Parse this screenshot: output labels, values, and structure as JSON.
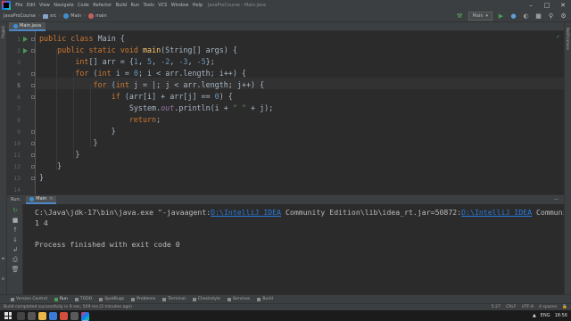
{
  "menubar": {
    "items": [
      "File",
      "Edit",
      "View",
      "Navigate",
      "Code",
      "Refactor",
      "Build",
      "Run",
      "Tools",
      "VCS",
      "Window",
      "Help"
    ],
    "window_title": "JavaProCourse - Main.java",
    "min_icon": "minimize-icon",
    "max_icon": "maximize-icon",
    "close_icon": "close-icon"
  },
  "navbar": {
    "breadcrumbs": [
      "JavaProCourse",
      "src",
      "Main",
      "main"
    ],
    "run_config": "Main"
  },
  "left_strip": {
    "labels": [
      "Project"
    ]
  },
  "right_strip": {
    "labels": [
      "Notifications"
    ]
  },
  "tabs": [
    {
      "label": "Main.java",
      "active": true
    }
  ],
  "editor": {
    "line_numbers": [
      "1",
      "2",
      "3",
      "4",
      "5",
      "6",
      "7",
      "8",
      "9",
      "10",
      "11",
      "12",
      "13",
      "14"
    ],
    "current_line": 5,
    "code": [
      [
        [
          "kw",
          "public "
        ],
        [
          "kw",
          "class "
        ],
        [
          "",
          "Main {"
        ]
      ],
      [
        [
          "",
          "    "
        ],
        [
          "kw",
          "public "
        ],
        [
          "kw",
          "static "
        ],
        [
          "kw",
          "void "
        ],
        [
          "fn",
          "main"
        ],
        [
          "",
          "(String[] args) {"
        ]
      ],
      [
        [
          "",
          "        "
        ],
        [
          "kw",
          "int"
        ],
        [
          "",
          "[] arr = {"
        ],
        [
          "num",
          "1"
        ],
        [
          "",
          ", "
        ],
        [
          "num",
          "5"
        ],
        [
          "",
          ", "
        ],
        [
          "num",
          "-2"
        ],
        [
          "",
          ", "
        ],
        [
          "num",
          "-3"
        ],
        [
          "",
          ", "
        ],
        [
          "num",
          "-5"
        ],
        [
          "",
          "};"
        ]
      ],
      [
        [
          "",
          "        "
        ],
        [
          "kw",
          "for "
        ],
        [
          "",
          "("
        ],
        [
          "kw",
          "int "
        ],
        [
          "",
          "i = "
        ],
        [
          "num",
          "0"
        ],
        [
          "",
          "; i < arr.length; i++) {"
        ]
      ],
      [
        [
          "",
          "            "
        ],
        [
          "kw",
          "for "
        ],
        [
          "",
          "("
        ],
        [
          "kw",
          "int "
        ],
        [
          "",
          "j = |; j < arr.length; j++) {"
        ]
      ],
      [
        [
          "",
          "                "
        ],
        [
          "kw",
          "if "
        ],
        [
          "",
          "(arr[i] + arr[j] == "
        ],
        [
          "num",
          "0"
        ],
        [
          "",
          ") {"
        ]
      ],
      [
        [
          "",
          "                    System."
        ],
        [
          "fld",
          "out"
        ],
        [
          "",
          ".println(i + "
        ],
        [
          "str",
          "\" \""
        ],
        [
          "",
          " + j);"
        ]
      ],
      [
        [
          "",
          "                    "
        ],
        [
          "kw",
          "return"
        ],
        [
          "",
          ";"
        ]
      ],
      [
        [
          "",
          "                }"
        ]
      ],
      [
        [
          "",
          "            }"
        ]
      ],
      [
        [
          "",
          "        }"
        ]
      ],
      [
        [
          "",
          "    }"
        ]
      ],
      [
        [
          "",
          "}"
        ]
      ],
      [
        [
          "",
          ""
        ]
      ]
    ]
  },
  "run_panel": {
    "label": "Run:",
    "tab": "Main",
    "console": [
      [
        [
          "",
          "C:\\Java\\jdk-17\\bin\\java.exe \"-javaagent:"
        ],
        [
          "link",
          "D:\\IntelliJ IDEA"
        ],
        [
          "",
          " Community Edition\\lib\\idea_rt.jar=50872:"
        ],
        [
          "link",
          "D:\\IntelliJ IDEA"
        ],
        [
          "",
          " Community Editi"
        ]
      ],
      [
        [
          "",
          "1 4"
        ]
      ],
      [
        [
          "",
          ""
        ]
      ],
      [
        [
          "",
          "Process finished with exit code 0"
        ]
      ]
    ]
  },
  "bottom_tools": {
    "items": [
      "Version Control",
      "Run",
      "TODO",
      "SpotBugs",
      "Problems",
      "Terminal",
      "Checkstyle",
      "Services",
      "Build"
    ],
    "active": "Run"
  },
  "status": {
    "message": "Build completed successfully in 9 sec, 509 ms (2 minutes ago)",
    "position": "5:27",
    "line_sep": "CRLF",
    "encoding": "UTF-8",
    "indent": "4 spaces"
  },
  "taskbar": {
    "time": "18:56",
    "lang": "ENG"
  }
}
